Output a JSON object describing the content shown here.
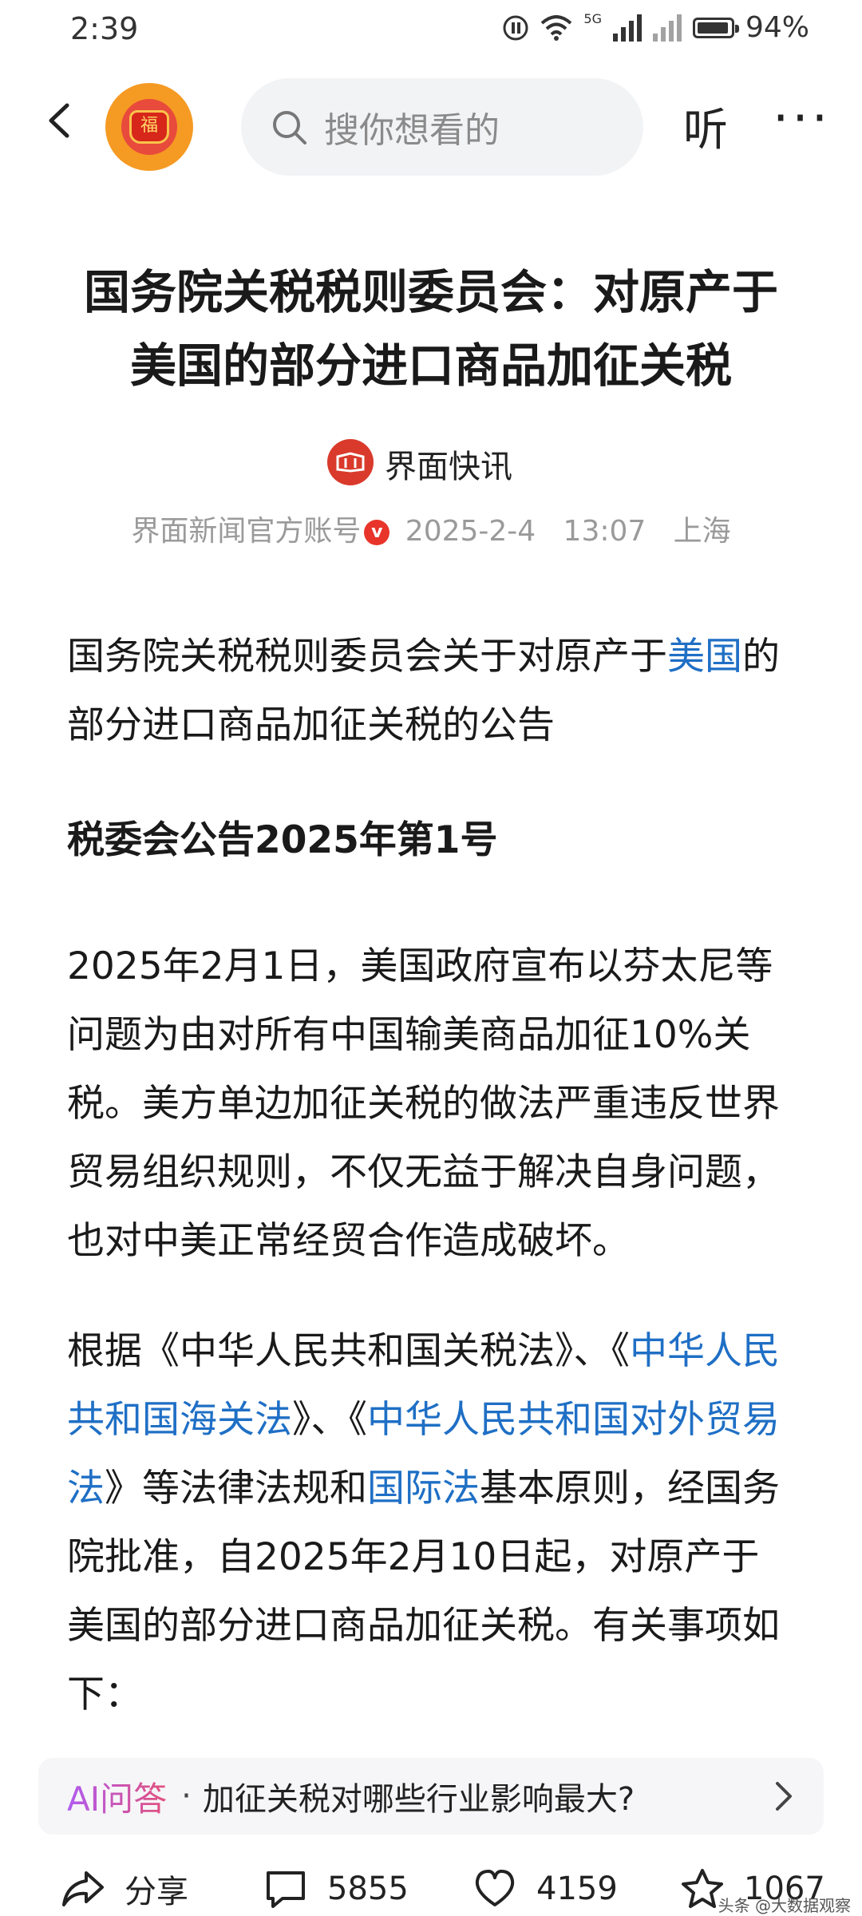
{
  "status": {
    "time": "2:39",
    "battery": "94%",
    "battery_level": 0.94,
    "network": "5G"
  },
  "header": {
    "search_placeholder": "搜你想看的",
    "listen_label": "听",
    "more_label": "···",
    "avatar_char": "福"
  },
  "article": {
    "title_line1": "国务院关税税则委员会：对原产于",
    "title_line2": "美国的部分进口商品加征关税",
    "source": "界面快讯",
    "account": "界面新闻官方账号",
    "verified_mark": "v",
    "date": "2025-2-4",
    "time": "13:07",
    "location": "上海",
    "p1_a": "国务院关税税则委员会关于对原产于",
    "p1_link": "美国",
    "p1_b": "的部分进口商品加征关税的公告",
    "p2": "税委会公告2025年第1号",
    "p3": "2025年2月1日，美国政府宣布以芬太尼等问题为由对所有中国输美商品加征10%关税。美方单边加征关税的做法严重违反世界贸易组织规则，不仅无益于解决自身问题，也对中美正常经贸合作造成破坏。",
    "p4_a": "根据《中华人民共和国关税法》、《",
    "p4_link1": "中华人民共和国海关法",
    "p4_b": "》、《",
    "p4_link2": "中华人民共和国对外贸易法",
    "p4_c": "》等法律法规和",
    "p4_link3": "国际法",
    "p4_d": "基本原则，经国务院批准，自2025年2月10日起，对原产于美国的部分进口商品加征关税。有关事项如下："
  },
  "ai": {
    "label": "AI问答",
    "dot": "·",
    "question": "加征关税对哪些行业影响最大?"
  },
  "bottom": {
    "share": "分享",
    "comments": "5855",
    "likes": "4159",
    "favorites": "1067"
  },
  "watermark": "头条 @大数据观察"
}
